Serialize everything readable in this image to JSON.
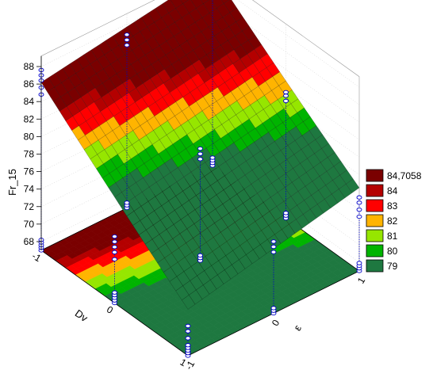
{
  "chart_data": {
    "type": "surface3d",
    "title": "",
    "zlabel": "Fr_15",
    "xlabel": "Dv",
    "ylabel": "ε",
    "x_range": [
      -1,
      1
    ],
    "y_range": [
      -1,
      1
    ],
    "z_range": [
      67,
      88
    ],
    "z_ticks": [
      "68",
      "70",
      "72",
      "74",
      "76",
      "78",
      "80",
      "82",
      "84",
      "86",
      "88"
    ],
    "x_ticks": [
      "-1",
      "0",
      "1"
    ],
    "y_ticks": [
      "-1",
      "0",
      "1"
    ],
    "legend_position": "right",
    "legend": [
      {
        "label": "84,7058",
        "color": "#7a0000"
      },
      {
        "label": "84",
        "color": "#b40000"
      },
      {
        "label": "83",
        "color": "#ff0000"
      },
      {
        "label": "82",
        "color": "#ffb400"
      },
      {
        "label": "81",
        "color": "#96e600"
      },
      {
        "label": "80",
        "color": "#00b400"
      },
      {
        "label": "79",
        "color": "#1e7840"
      }
    ],
    "observations": [
      {
        "x": -1,
        "y": -1,
        "z": [
          84.8,
          85.6,
          86.4,
          87.0,
          87.6
        ]
      },
      {
        "x": -1,
        "y": 0,
        "z": [
          85.6,
          86.2,
          86.8
        ]
      },
      {
        "x": -1,
        "y": 1,
        "z": [
          86.4,
          87.0,
          87.6,
          88.0
        ]
      },
      {
        "x": 0,
        "y": -1,
        "z": [
          72.0,
          72.8,
          73.4,
          74.0,
          74.6
        ]
      },
      {
        "x": 0,
        "y": 0,
        "z": [
          78.6,
          79.2,
          79.8
        ]
      },
      {
        "x": 0,
        "y": 1,
        "z": [
          80.4,
          81.0,
          81.4
        ]
      },
      {
        "x": 1,
        "y": -1,
        "z": [
          67.4,
          68.2,
          69.0,
          69.8,
          70.4
        ]
      },
      {
        "x": 1,
        "y": 0,
        "z": [
          74.0,
          74.6,
          75.2
        ]
      },
      {
        "x": 1,
        "y": 1,
        "z": [
          73.2,
          74.0,
          74.8,
          75.4
        ]
      }
    ]
  }
}
